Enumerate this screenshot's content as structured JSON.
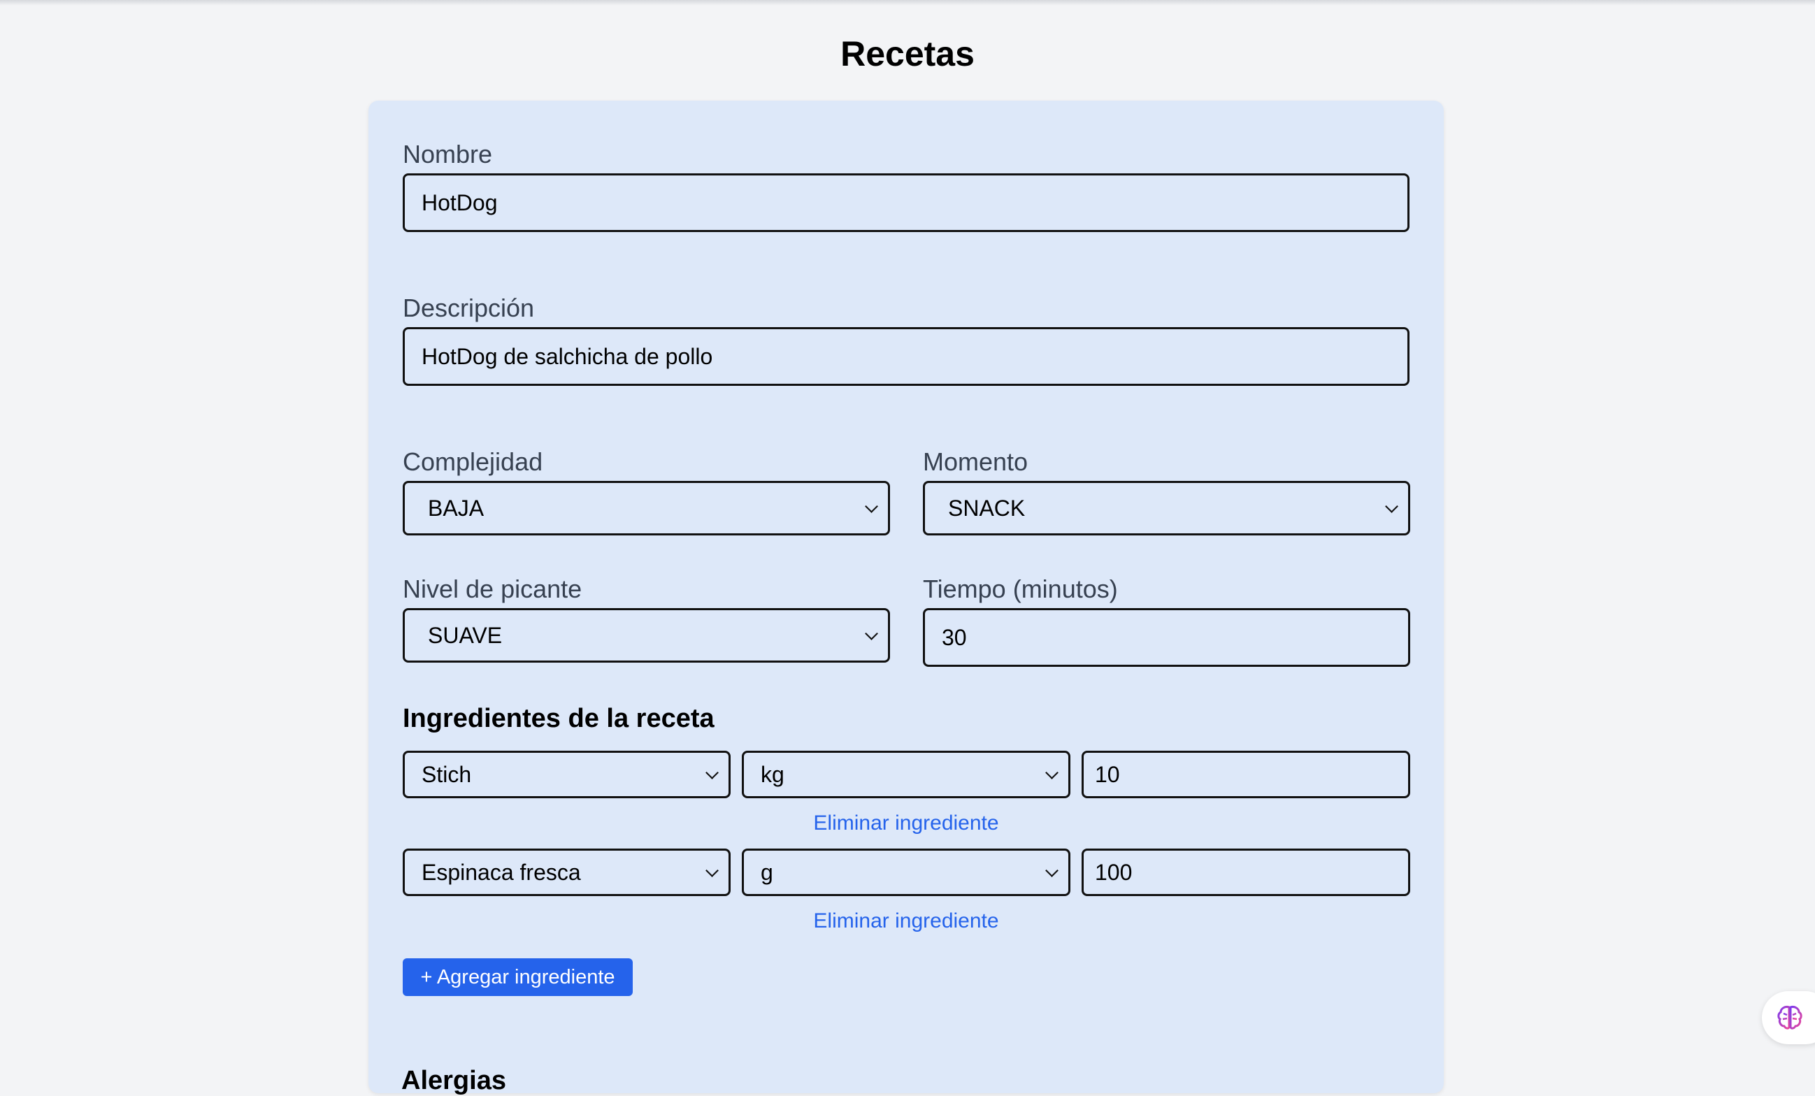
{
  "page": {
    "title": "Recetas"
  },
  "form": {
    "nombre": {
      "label": "Nombre",
      "value": "HotDog"
    },
    "descripcion": {
      "label": "Descripción",
      "value": "HotDog de salchicha de pollo"
    },
    "complejidad": {
      "label": "Complejidad",
      "value": "BAJA"
    },
    "momento": {
      "label": "Momento",
      "value": "SNACK"
    },
    "picante": {
      "label": "Nivel de picante",
      "value": "SUAVE"
    },
    "tiempo": {
      "label": "Tiempo (minutos)",
      "value": "30"
    }
  },
  "ingredients": {
    "title": "Ingredientes de la receta",
    "rows": [
      {
        "name": "Stich",
        "unit": "kg",
        "qty": "10",
        "remove_label": "Eliminar ingrediente"
      },
      {
        "name": "Espinaca fresca",
        "unit": "g",
        "qty": "100",
        "remove_label": "Eliminar ingrediente"
      }
    ],
    "add_label": "+ Agregar ingrediente"
  },
  "alergias": {
    "title": "Alergias"
  },
  "floating": {
    "icon": "brain-icon"
  }
}
